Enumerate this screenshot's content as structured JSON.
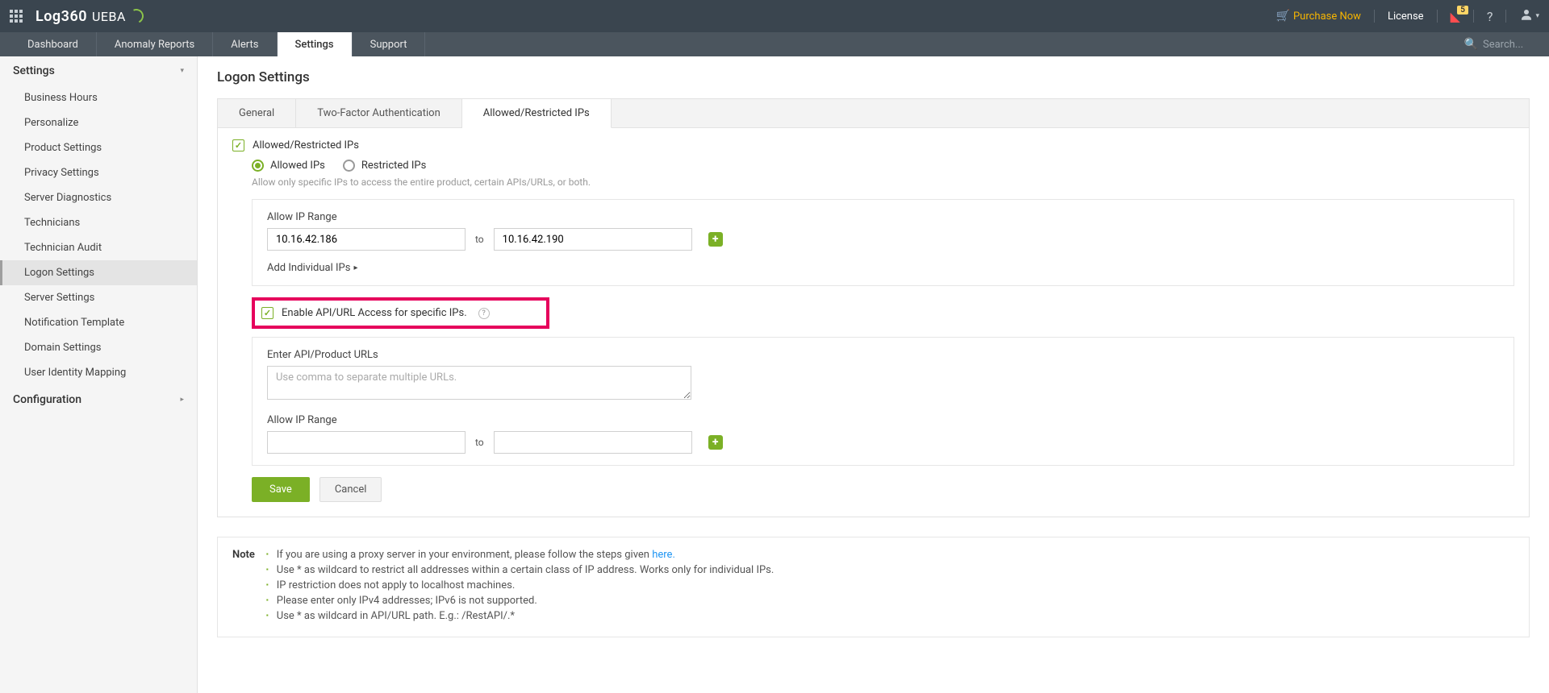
{
  "app": {
    "name": "Log360",
    "suffix": "UEBA"
  },
  "topbar": {
    "purchase": "Purchase Now",
    "license": "License",
    "notif_count": "5",
    "search_placeholder": "Search..."
  },
  "nav": {
    "items": [
      "Dashboard",
      "Anomaly Reports",
      "Alerts",
      "Settings",
      "Support"
    ],
    "active": 3
  },
  "sidebar": {
    "groups": [
      {
        "title": "Settings",
        "items": [
          "Business Hours",
          "Personalize",
          "Product Settings",
          "Privacy Settings",
          "Server Diagnostics",
          "Technicians",
          "Technician Audit",
          "Logon Settings",
          "Server Settings",
          "Notification Template",
          "Domain Settings",
          "User Identity Mapping"
        ],
        "active": 7
      },
      {
        "title": "Configuration",
        "items": []
      }
    ]
  },
  "page": {
    "title": "Logon Settings"
  },
  "tabs": {
    "items": [
      "General",
      "Two-Factor Authentication",
      "Allowed/Restricted IPs"
    ],
    "active": 2
  },
  "form": {
    "master_label": "Allowed/Restricted IPs",
    "radios": {
      "allowed": "Allowed IPs",
      "restricted": "Restricted IPs"
    },
    "help": "Allow only specific IPs to access the entire product, certain APIs/URLs, or both.",
    "ip_range_label": "Allow IP Range",
    "ip_from": "10.16.42.186",
    "to": "to",
    "ip_to": "10.16.42.190",
    "add_individual": "Add Individual IPs",
    "api_checkbox": "Enable API/URL Access for specific IPs.",
    "api_urls_label": "Enter API/Product URLs",
    "api_urls_placeholder": "Use comma to separate multiple URLs.",
    "api_range_label": "Allow IP Range",
    "save": "Save",
    "cancel": "Cancel"
  },
  "note": {
    "label": "Note",
    "items": [
      {
        "pre": "If you are using a proxy server in your environment, please follow the steps given ",
        "link": "here."
      },
      {
        "text": "Use * as wildcard to restrict all addresses within a certain class of IP address. Works only for individual IPs."
      },
      {
        "text": "IP restriction does not apply to localhost machines."
      },
      {
        "text": "Please enter only IPv4 addresses; IPv6 is not supported."
      },
      {
        "text": "Use * as wildcard in API/URL path. E.g.: /RestAPI/.*"
      }
    ]
  }
}
